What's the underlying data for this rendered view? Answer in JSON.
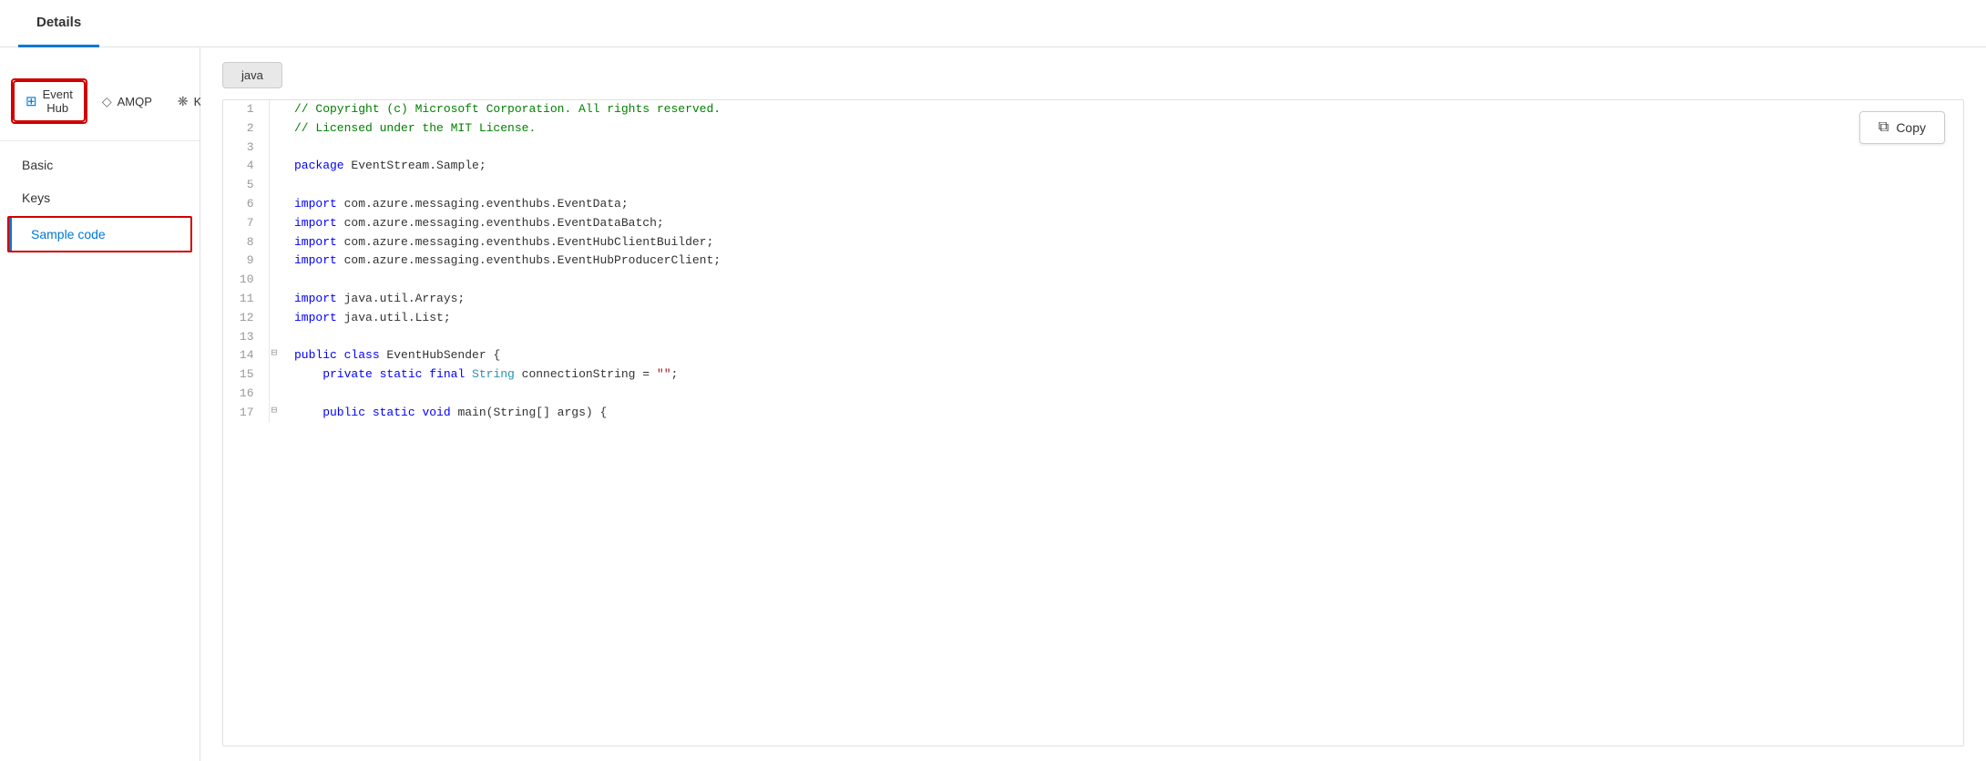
{
  "header": {
    "tab_label": "Details"
  },
  "sidebar": {
    "protocols": [
      {
        "id": "event-hub",
        "label": "Event Hub",
        "icon": "grid",
        "active": true
      },
      {
        "id": "amqp",
        "label": "AMQP",
        "icon": "diamond",
        "active": false
      },
      {
        "id": "kafka",
        "label": "Kafka",
        "icon": "nodes",
        "active": false
      }
    ],
    "nav_items": [
      {
        "id": "basic",
        "label": "Basic",
        "active": false
      },
      {
        "id": "keys",
        "label": "Keys",
        "active": false
      },
      {
        "id": "sample-code",
        "label": "Sample code",
        "active": true
      }
    ]
  },
  "content": {
    "languages": [
      {
        "id": "java",
        "label": "java",
        "active": true
      }
    ],
    "copy_button_label": "Copy",
    "code_lines": [
      {
        "num": 1,
        "fold": false,
        "tokens": [
          {
            "text": "// Copyright (c) Microsoft Corporation. All rights reserved.",
            "cls": "kw-green"
          }
        ]
      },
      {
        "num": 2,
        "fold": false,
        "tokens": [
          {
            "text": "// Licensed under the MIT License.",
            "cls": "kw-green"
          }
        ]
      },
      {
        "num": 3,
        "fold": false,
        "tokens": []
      },
      {
        "num": 4,
        "fold": false,
        "tokens": [
          {
            "text": "package ",
            "cls": "kw-blue"
          },
          {
            "text": "EventStream.Sample;",
            "cls": ""
          }
        ]
      },
      {
        "num": 5,
        "fold": false,
        "tokens": []
      },
      {
        "num": 6,
        "fold": false,
        "tokens": [
          {
            "text": "import ",
            "cls": "kw-blue"
          },
          {
            "text": "com.azure.messaging.eventhubs.EventData;",
            "cls": ""
          }
        ]
      },
      {
        "num": 7,
        "fold": false,
        "tokens": [
          {
            "text": "import ",
            "cls": "kw-blue"
          },
          {
            "text": "com.azure.messaging.eventhubs.EventDataBatch;",
            "cls": ""
          }
        ]
      },
      {
        "num": 8,
        "fold": false,
        "tokens": [
          {
            "text": "import ",
            "cls": "kw-blue"
          },
          {
            "text": "com.azure.messaging.eventhubs.EventHubClientBuilder;",
            "cls": ""
          }
        ]
      },
      {
        "num": 9,
        "fold": false,
        "tokens": [
          {
            "text": "import ",
            "cls": "kw-blue"
          },
          {
            "text": "com.azure.messaging.eventhubs.EventHubProducerClient;",
            "cls": ""
          }
        ]
      },
      {
        "num": 10,
        "fold": false,
        "tokens": []
      },
      {
        "num": 11,
        "fold": false,
        "tokens": [
          {
            "text": "import ",
            "cls": "kw-blue"
          },
          {
            "text": "java.util.Arrays;",
            "cls": ""
          }
        ]
      },
      {
        "num": 12,
        "fold": false,
        "tokens": [
          {
            "text": "import ",
            "cls": "kw-blue"
          },
          {
            "text": "java.util.List;",
            "cls": ""
          }
        ]
      },
      {
        "num": 13,
        "fold": false,
        "tokens": []
      },
      {
        "num": 14,
        "fold": true,
        "tokens": [
          {
            "text": "public ",
            "cls": "kw-blue"
          },
          {
            "text": "class ",
            "cls": "kw-blue"
          },
          {
            "text": "EventHubSender {",
            "cls": ""
          }
        ]
      },
      {
        "num": 15,
        "fold": false,
        "tokens": [
          {
            "text": "    private ",
            "cls": "kw-blue"
          },
          {
            "text": "static ",
            "cls": "kw-blue"
          },
          {
            "text": "final ",
            "cls": "kw-blue"
          },
          {
            "text": "String ",
            "cls": "kw-type"
          },
          {
            "text": "connectionString = ",
            "cls": ""
          },
          {
            "text": "\"\"",
            "cls": "kw-string"
          },
          {
            "text": ";",
            "cls": ""
          }
        ]
      },
      {
        "num": 16,
        "fold": false,
        "tokens": []
      },
      {
        "num": 17,
        "fold": true,
        "tokens": [
          {
            "text": "    public ",
            "cls": "kw-blue"
          },
          {
            "text": "static ",
            "cls": "kw-blue"
          },
          {
            "text": "void ",
            "cls": "kw-blue"
          },
          {
            "text": "main(String[] args) {",
            "cls": ""
          }
        ]
      }
    ]
  }
}
